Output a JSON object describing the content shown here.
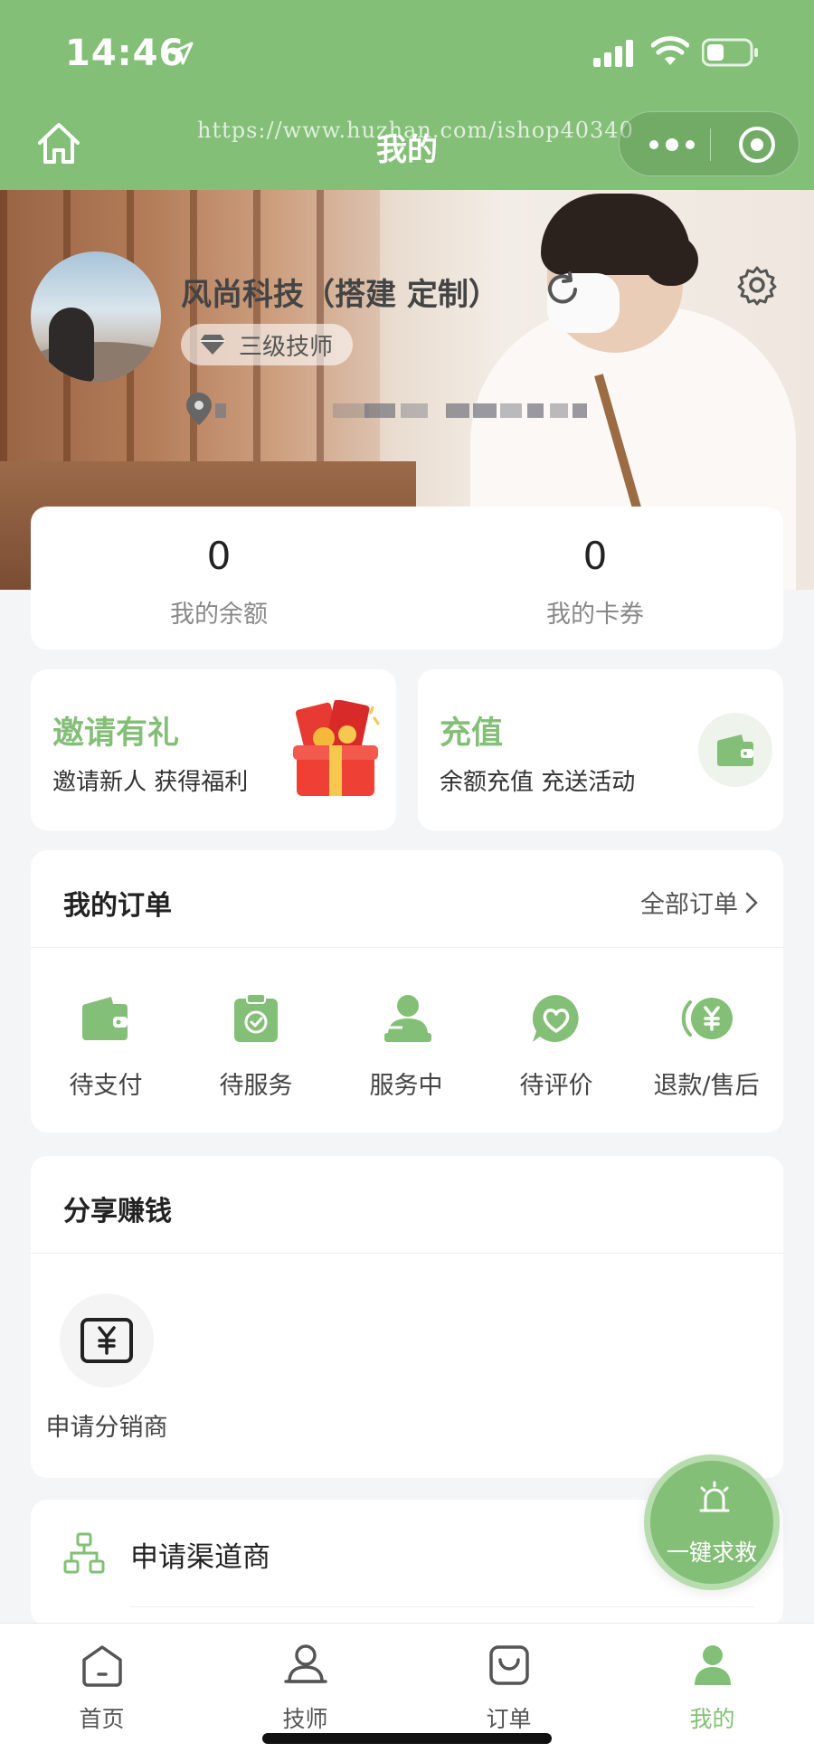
{
  "status_bar": {
    "time": "14:46"
  },
  "navbar": {
    "title": "我的",
    "watermark": "https://www.huzhan.com/ishop40340"
  },
  "profile": {
    "name": "风尚科技（搭建 定制）",
    "level": "三级技师"
  },
  "balance": [
    {
      "value": "0",
      "label": "我的余额"
    },
    {
      "value": "0",
      "label": "我的卡券"
    }
  ],
  "promos": {
    "invite": {
      "title": "邀请有礼",
      "subtitle": "邀请新人 获得福利"
    },
    "recharge": {
      "title": "充值",
      "subtitle": "余额充值 充送活动"
    }
  },
  "orders": {
    "title": "我的订单",
    "all_label": "全部订单",
    "items": [
      {
        "label": "待支付",
        "icon": "wallet-icon"
      },
      {
        "label": "待服务",
        "icon": "clipboard-check-icon"
      },
      {
        "label": "服务中",
        "icon": "person-service-icon"
      },
      {
        "label": "待评价",
        "icon": "heart-chat-icon"
      },
      {
        "label": "退款/售后",
        "icon": "yuan-refund-icon"
      }
    ]
  },
  "share": {
    "title": "分享赚钱",
    "distributor_label": "申请分销商"
  },
  "channel": {
    "label": "申请渠道商"
  },
  "sos": {
    "label": "一键求救"
  },
  "tabs": [
    {
      "label": "首页",
      "icon": "home-icon",
      "active": false
    },
    {
      "label": "技师",
      "icon": "technician-icon",
      "active": false
    },
    {
      "label": "订单",
      "icon": "order-bag-icon",
      "active": false
    },
    {
      "label": "我的",
      "icon": "user-icon",
      "active": true
    }
  ],
  "colors": {
    "brand": "#83bf77",
    "brand_light": "#b7dcae",
    "background": "#f4f5f7",
    "text": "#222222",
    "muted": "#888888"
  }
}
